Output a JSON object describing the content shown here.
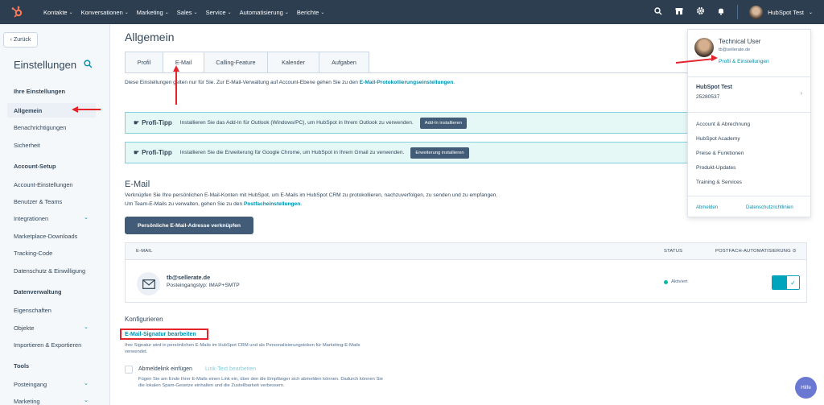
{
  "topnav": {
    "items": [
      "Kontakte",
      "Konversationen",
      "Marketing",
      "Sales",
      "Service",
      "Automatisierung",
      "Berichte"
    ],
    "account_name": "HubSpot Test"
  },
  "sidebar": {
    "back_label": "Zurück",
    "title": "Einstellungen",
    "sections": [
      {
        "heading": "Ihre Einstellungen",
        "items": [
          "Allgemein",
          "Benachrichtigungen",
          "Sicherheit"
        ]
      },
      {
        "heading": "Account-Setup",
        "items": [
          "Account-Einstellungen",
          "Benutzer & Teams",
          "Integrationen",
          "Marketplace-Downloads",
          "Tracking-Code",
          "Datenschutz & Einwilligung"
        ]
      },
      {
        "heading": "Datenverwaltung",
        "items": [
          "Eigenschaften",
          "Objekte",
          "Importieren & Exportieren"
        ]
      },
      {
        "heading": "Tools",
        "items": [
          "Posteingang",
          "Marketing"
        ]
      }
    ]
  },
  "main": {
    "title": "Allgemein",
    "tabs": [
      "Profil",
      "E-Mail",
      "Calling-Feature",
      "Kalender",
      "Aufgaben"
    ],
    "info_text": "Diese Einstellungen gelten nur für Sie. Zur E-Mail-Verwaltung auf Account-Ebene gehen Sie zu den ",
    "info_link": "E-Mail-Protokollierungseinstellungen",
    "info_end": ".",
    "tips": [
      {
        "label": "Profi-Tipp",
        "text": "Installieren Sie das Add-In für Outlook (Windows/PC), um HubSpot in Ihrem Outlook zu verwenden.",
        "button": "Add-In installieren"
      },
      {
        "label": "Profi-Tipp",
        "text": "Installieren Sie die Erweiterung für Google Chrome, um HubSpot in Ihrem Gmail zu verwenden.",
        "button": "Erweiterung installieren"
      }
    ],
    "email_section": {
      "title": "E-Mail",
      "desc": "Verknüpfen Sie Ihre persönlichen E-Mail-Konten mit HubSpot, um E-Mails im HubSpot CRM zu protokollieren, nachzuverfolgen, zu senden und zu empfangen. Um Team-E-Mails zu verwalten, gehen Sie zu den ",
      "desc_link": "Postfacheinstellungen",
      "desc_end": ".",
      "button": "Persönliche E-Mail-Adresse verknüpfen"
    },
    "table": {
      "headers": [
        "E-MAIL",
        "STATUS",
        "POSTFACH-AUTOMATISIERUNG"
      ],
      "row": {
        "email": "tb@sellerate.de",
        "type": "Posteingangstyp: IMAP+SMTP",
        "status": "Aktiviert"
      }
    },
    "configure": {
      "title": "Konfigurieren",
      "signature_link": "E-Mail-Signatur bearbeiten",
      "signature_desc": "Ihre Signatur wird in persönlichen E-Mails im HubSpot CRM und als Personalisierungstoken für Marketing-E-Mails verwendet.",
      "unsubscribe_label": "Abmeldelink einfügen",
      "unsubscribe_link": "Link-Text bearbeiten",
      "unsubscribe_desc": "Fügen Sie am Ende Ihrer E-Mails einen Link ein, über den die Empfänger sich abmelden können. Dadurch können Sie die lokalen Spam-Gesetze einhalten und die Zustellbarkeit verbessern."
    }
  },
  "dropdown": {
    "user_name": "Technical User",
    "user_email": "tb@sellerate.de",
    "profile_link": "Profil & Einstellungen",
    "account_name": "HubSpot Test",
    "account_id": "25280537",
    "items": [
      "Account & Abrechnung",
      "HubSpot Academy",
      "Preise & Funktionen",
      "Produkt-Updates",
      "Training & Services"
    ],
    "logout": "Abmelden",
    "privacy": "Datenschutzrichtlinien"
  },
  "help_label": "Hilfe",
  "colors": {
    "nav_bg": "#2d3e50",
    "accent": "#0091ae",
    "brand": "#ff7a59",
    "annotation": "#e3242b"
  }
}
